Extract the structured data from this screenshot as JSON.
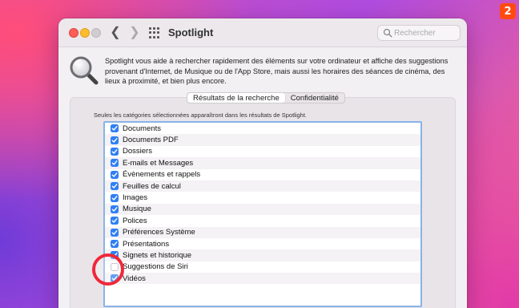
{
  "badge": "2",
  "window": {
    "title": "Spotlight",
    "search_placeholder": "Rechercher",
    "description": "Spotlight vous aide à rechercher rapidement des éléments sur votre ordinateur et affiche des suggestions provenant d'Internet, de Musique ou de l'App Store, mais aussi les horaires des séances de cinéma, des lieux à proximité, et bien plus encore.",
    "tabs": [
      "Résultats de la recherche",
      "Confidentialité"
    ],
    "active_tab": "Résultats de la recherche",
    "note": "Seules les catégories sélectionnées apparaîtront dans les résultats de Spotlight."
  },
  "categories": [
    {
      "label": "Documents",
      "checked": true
    },
    {
      "label": "Documents PDF",
      "checked": true
    },
    {
      "label": "Dossiers",
      "checked": true
    },
    {
      "label": "E-mails et Messages",
      "checked": true
    },
    {
      "label": "Évènements et rappels",
      "checked": true
    },
    {
      "label": "Feuilles de calcul",
      "checked": true
    },
    {
      "label": "Images",
      "checked": true
    },
    {
      "label": "Musique",
      "checked": true
    },
    {
      "label": "Polices",
      "checked": true
    },
    {
      "label": "Préférences Système",
      "checked": true
    },
    {
      "label": "Présentations",
      "checked": true
    },
    {
      "label": "Signets et historique",
      "checked": true
    },
    {
      "label": "Suggestions de Siri",
      "checked": false
    },
    {
      "label": "Vidéos",
      "checked": true
    }
  ],
  "colors": {
    "accent": "#2f7ff5",
    "highlight": "#f0283a",
    "badge": "#ff4a14"
  }
}
